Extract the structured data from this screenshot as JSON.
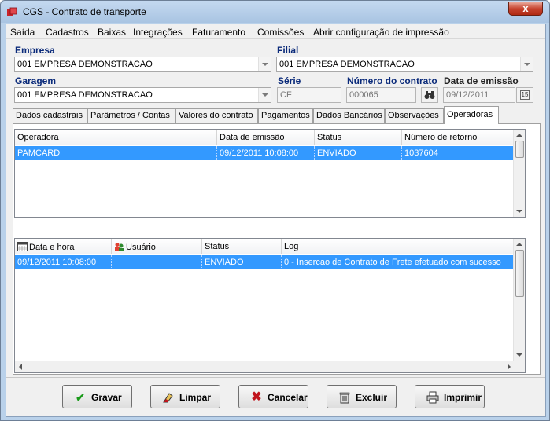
{
  "window": {
    "title": "CGS - Contrato de transporte",
    "close_glyph": "x"
  },
  "menu": [
    "Saída",
    "Cadastros",
    "Baixas",
    "Integrações",
    "Faturamento",
    "Comissões",
    "Abrir configuração de impressão"
  ],
  "form": {
    "empresa_label": "Empresa",
    "empresa_value": "001 EMPRESA DEMONSTRACAO",
    "filial_label": "Filial",
    "filial_value": "001 EMPRESA DEMONSTRACAO",
    "garagem_label": "Garagem",
    "garagem_value": "001 EMPRESA DEMONSTRACAO",
    "serie_label": "Série",
    "serie_value": "CF",
    "numero_label": "Número do contrato",
    "numero_value": "000065",
    "data_label": "Data de emissão",
    "data_value": "09/12/2011",
    "calendar_btn": "15"
  },
  "tabs": [
    "Dados cadastrais",
    "Parâmetros / Contas",
    "Valores do contrato",
    "Pagamentos",
    "Dados Bancários",
    "Observações",
    "Operadoras"
  ],
  "operadoras_grid": {
    "columns": [
      "Operadora",
      "Data de emissão",
      "Status",
      "Número de retorno"
    ],
    "rows": [
      [
        "PAMCARD",
        "09/12/2011 10:08:00",
        "ENVIADO",
        "1037604"
      ]
    ]
  },
  "log_grid": {
    "columns": [
      "Data e hora",
      "Usuário",
      "Status",
      "Log"
    ],
    "rows": [
      [
        "09/12/2011 10:08:00",
        "",
        "ENVIADO",
        "0 - Insercao de Contrato de Frete efetuado com sucesso"
      ]
    ]
  },
  "buttons": {
    "gravar": "Gravar",
    "limpar": "Limpar",
    "cancelar": "Cancelar",
    "excluir": "Excluir",
    "imprimir": "Imprimir"
  },
  "colors": {
    "selection": "#3399ff",
    "label_blue": "#0a2a7a",
    "cancel_red": "#c0141c",
    "check_green": "#1a9a1a"
  }
}
